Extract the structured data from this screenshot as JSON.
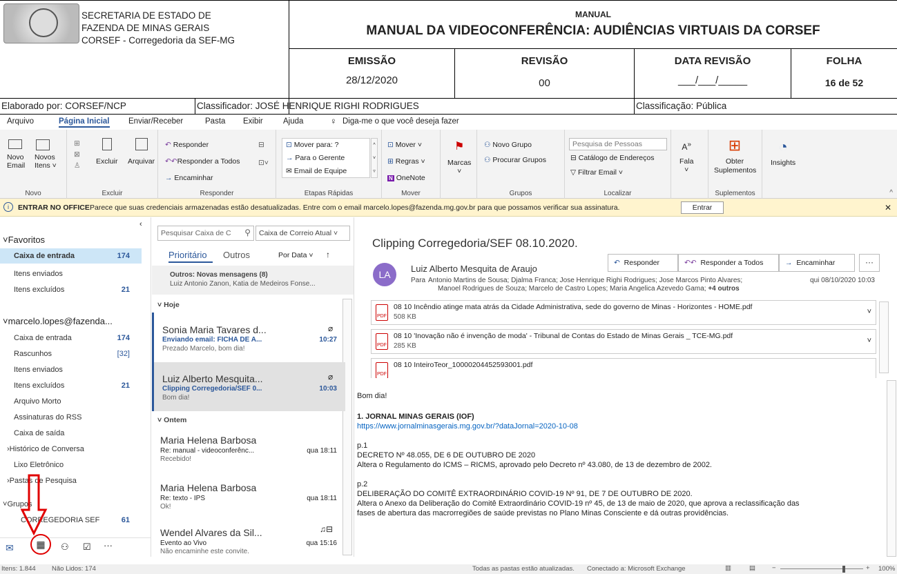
{
  "doc_header": {
    "org_line1": "SECRETARIA DE ESTADO DE",
    "org_line2": "FAZENDA DE MINAS GERAIS",
    "org_line3": "CORSEF - Corregedoria da SEF-MG",
    "manual_label": "MANUAL",
    "title": "MANUAL DA VIDEOCONFERÊNCIA:  AUDIÊNCIAS VIRTUAIS DA CORSEF",
    "emissao_label": "EMISSÃO",
    "emissao_value": "28/12/2020",
    "revisao_label": "REVISÃO",
    "revisao_value": "00",
    "data_revisao_label": "DATA REVISÃO",
    "data_revisao_value": "___/___/_____",
    "folha_label": "FOLHA",
    "folha_value": "16 de 52",
    "elaborado": "Elaborado por: CORSEF/NCP",
    "classificador": "Classificador: JOSÉ HENRIQUE RIGHI RODRIGUES",
    "classificacao": "Classificação: Pública"
  },
  "ribbon_tabs": [
    "Arquivo",
    "Página Inicial",
    "Enviar/Receber",
    "Pasta",
    "Exibir",
    "Ajuda",
    "Diga-me o que você deseja fazer"
  ],
  "ribbon": {
    "novo_email": "Novo\nEmail",
    "novos_itens": "Novos\nItens ˅",
    "novo_group": "Novo",
    "excluir": "Excluir",
    "arquivar": "Arquivar",
    "excluir_group": "Excluir",
    "responder": "Responder",
    "responder_todos": "Responder a Todos",
    "encaminhar": "Encaminhar",
    "responder_group": "Responder",
    "mover_para": "Mover para: ?",
    "para_gerente": "Para o Gerente",
    "email_equipe": "Email de Equipe",
    "etapas_group": "Etapas Rápidas",
    "mover": "Mover ˅",
    "regras": "Regras ˅",
    "onenote": "OneNote",
    "mover_group": "Mover",
    "marcas": "Marcas",
    "novo_grupo": "Novo Grupo",
    "procurar_grupos": "Procurar Grupos",
    "grupos_group": "Grupos",
    "pesquisa_pessoas": "Pesquisa de Pessoas",
    "catalogo": "Catálogo de Endereços",
    "filtrar_email": "Filtrar Email ˅",
    "localizar_group": "Localizar",
    "fala": "Fala",
    "obter": "Obter\nSuplementos",
    "suplementos_group": "Suplementos",
    "insights": "Insights"
  },
  "infobar": {
    "title": "ENTRAR NO OFFICE",
    "text": "Parece que suas credenciais armazenadas estão desatualizadas. Entre com o email marcelo.lopes@fazenda.mg.gov.br para que possamos verificar sua assinatura.",
    "button": "Entrar"
  },
  "folders": {
    "favoritos": "Favoritos",
    "fav_items": [
      {
        "name": "Caixa de entrada",
        "count": "174"
      },
      {
        "name": "Itens enviados",
        "count": ""
      },
      {
        "name": "Itens excluídos",
        "count": "21"
      }
    ],
    "account": "marcelo.lopes@fazenda...",
    "acc_items": [
      {
        "name": "Caixa de entrada",
        "count": "174"
      },
      {
        "name": "Rascunhos",
        "count": "[32]"
      },
      {
        "name": "Itens enviados",
        "count": ""
      },
      {
        "name": "Itens excluídos",
        "count": "21"
      },
      {
        "name": "Arquivo Morto",
        "count": ""
      },
      {
        "name": "Assinaturas do RSS",
        "count": ""
      },
      {
        "name": "Caixa de saída",
        "count": ""
      },
      {
        "name": "Histórico de Conversa",
        "count": ""
      },
      {
        "name": "Lixo Eletrônico",
        "count": ""
      },
      {
        "name": "Pastas de Pesquisa",
        "count": ""
      }
    ],
    "grupos": "Grupos",
    "grupo_item": "CORREGEDORIA SEF",
    "grupo_count": "61"
  },
  "list": {
    "search_placeholder": "Pesquisar Caixa de C",
    "scope": "Caixa de Correio Atual",
    "tab_prioritario": "Prioritário",
    "tab_outros": "Outros",
    "sort": "Por Data ˅",
    "outros_title": "Outros: Novas mensagens (8)",
    "outros_sub": "Luiz Antonio Zanon, Katia de Medeiros Fonse...",
    "hoje": "Hoje",
    "ontem": "Ontem",
    "messages": [
      {
        "sender": "Sonia Maria Tavares d...",
        "subject": "Enviando email: FICHA DE A...",
        "time": "10:27",
        "preview": "Prezado Marcelo, bom dia!"
      },
      {
        "sender": "Luiz Alberto Mesquita...",
        "subject": "Clipping Corregedoria/SEF 0...",
        "time": "10:03",
        "preview": "Bom dia!"
      },
      {
        "sender": "Maria Helena Barbosa",
        "subject": "Re: manual - videoconferênc...",
        "time": "qua 18:11",
        "preview": "Recebido!"
      },
      {
        "sender": "Maria Helena Barbosa",
        "subject": "Re: texto - IPS",
        "time": "qua 18:11",
        "preview": "Ok!"
      },
      {
        "sender": "Wendel Alvares da Sil...",
        "subject": "Evento ao Vivo",
        "time": "qua 15:16",
        "preview": "Não encaminhe este convite."
      }
    ]
  },
  "reading": {
    "subject": "Clipping Corregedoria/SEF 08.10.2020.",
    "avatar": "LA",
    "from": "Luiz Alberto Mesquita de Araujo",
    "to_label": "Para",
    "to_line1": "Antonio Martins de Sousa; Djalma Franca; Jose Henrique Righi Rodrigues; Jose Marcos Pinto Alvares;",
    "to_line2": "Manoel Rodrigues de Souza; Marcelo de Castro Lopes; Maria Angelica Azevedo Gama;",
    "more": "+4 outros",
    "date": "qui 08/10/2020 10:03",
    "btn_responder": "Responder",
    "btn_todos": "Responder a Todos",
    "btn_encaminhar": "Encaminhar",
    "attachments": [
      {
        "name": "08 10 Incêndio atinge mata atrás da Cidade Administrativa, sede do governo de Minas - Horizontes - HOME.pdf",
        "size": "508 KB"
      },
      {
        "name": "08 10 'Inovação não é invenção de moda' - Tribunal de Contas do Estado de Minas Gerais _ TCE-MG.pdf",
        "size": "285 KB"
      },
      {
        "name": "08 10 InteiroTeor_10000204452593001.pdf",
        "size": ""
      }
    ],
    "body": {
      "greet": "Bom dia!",
      "h1": "1. JORNAL MINAS GERAIS (IOF)",
      "link": "https://www.jornalminasgerais.mg.gov.br/?dataJornal=2020-10-08",
      "p1": "p.1",
      "dec": "DECRETO Nº 48.055, DE 6 DE OUTUBRO DE 2020",
      "dec_text": "Altera o Regulamento do ICMS – RICMS, aprovado pelo Decreto nº 43.080, de 13 de dezembro de 2002.",
      "p2": "p.2",
      "delib": "DELIBERAÇÃO DO COMITÊ EXTRAORDINÁRIO COVID-19 Nº 91, DE 7 DE OUTUBRO DE 2020.",
      "delib1": "Altera o Anexo da Deliberação do Comitê Extraordinário COVID-19 nº 45, de 13 de maio de 2020, que aprova a reclassificação das",
      "delib2": "fases de abertura das macrorregiões de saúde previstas no Plano Minas Consciente e dá outras providências."
    }
  },
  "status": {
    "items": "Itens: 1.844",
    "unread": "Não Lidos: 174",
    "sync": "Todas as pastas estão atualizadas.",
    "conn": "Conectado a: Microsoft Exchange",
    "zoom": "100%"
  },
  "colors": {
    "accent": "#2b579a",
    "highlight": "#e00000"
  }
}
